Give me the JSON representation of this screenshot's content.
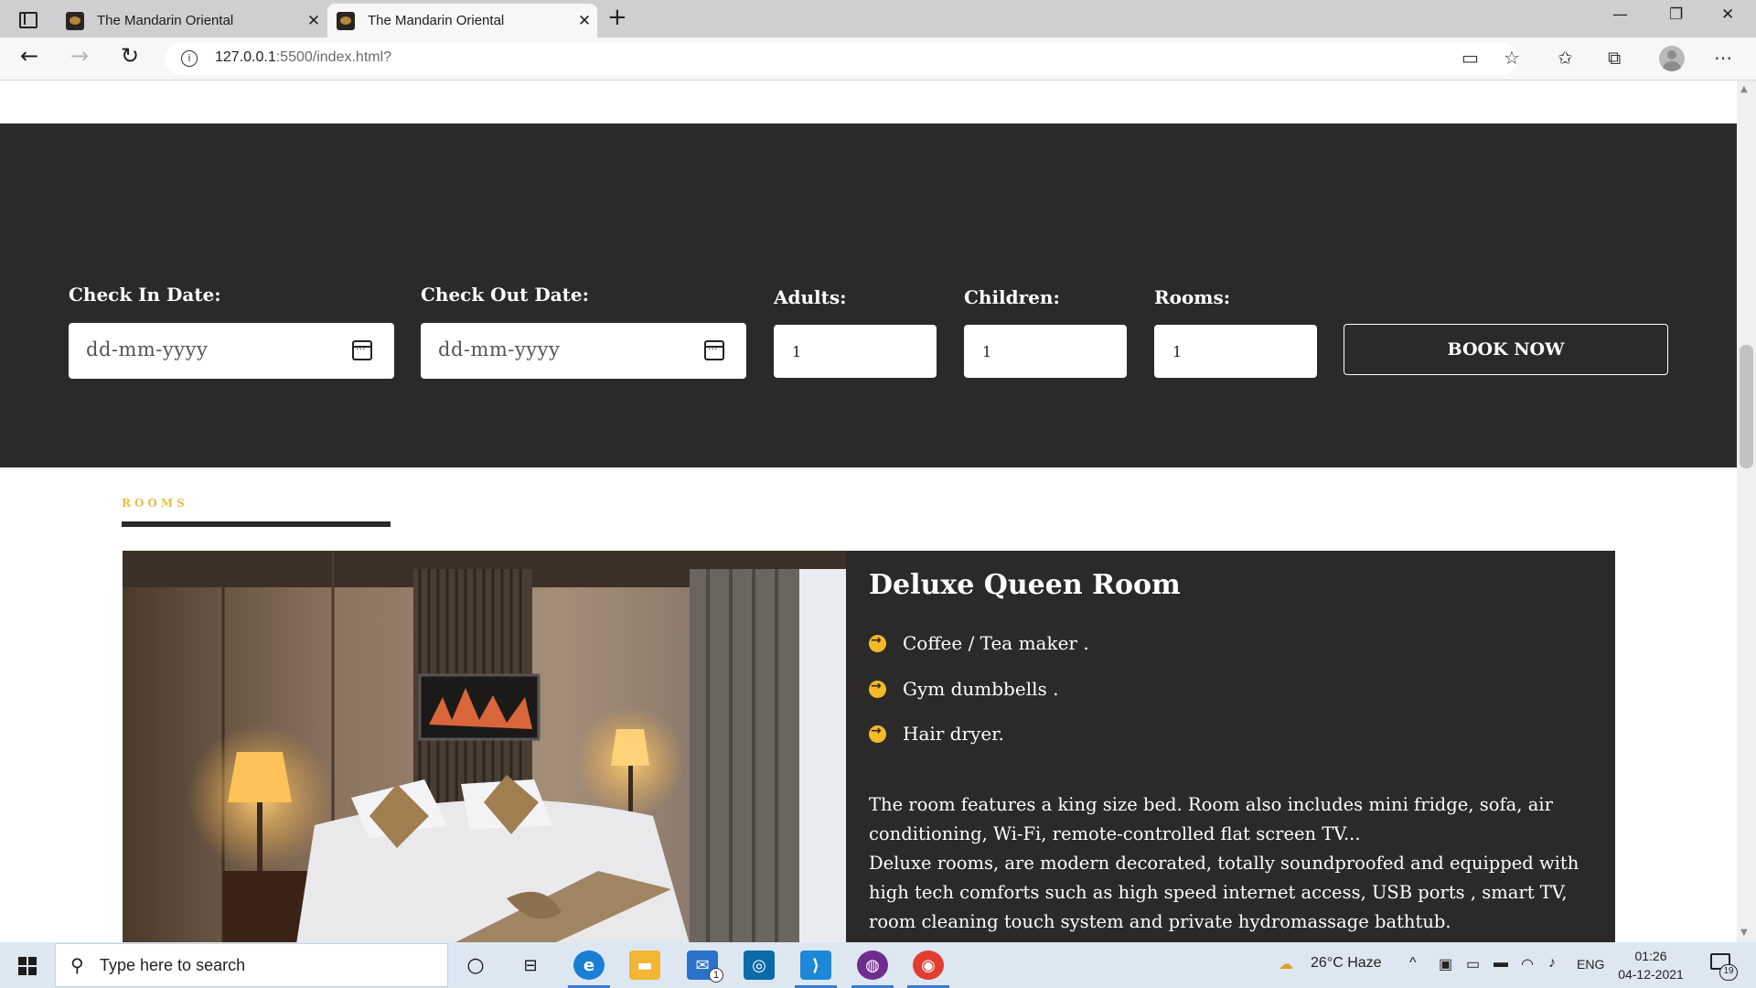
{
  "browser": {
    "tabs": [
      {
        "title": "The Mandarin Oriental",
        "active": false
      },
      {
        "title": "The Mandarin Oriental",
        "active": true
      }
    ],
    "new_tab": "+",
    "url_host": "127.0.0.1",
    "url_rest": ":5500/index.html?",
    "window_controls": {
      "minimize": "—",
      "maximize": "❐",
      "close": "✕"
    }
  },
  "booking": {
    "check_in": {
      "label": "Check  In  Date:",
      "placeholder": "dd-mm-yyyy"
    },
    "check_out": {
      "label": "Check  Out  Date:",
      "placeholder": "dd-mm-yyyy"
    },
    "adults": {
      "label": "Adults:",
      "value": "1"
    },
    "children": {
      "label": "Children:",
      "value": "1"
    },
    "rooms": {
      "label": "Rooms:",
      "value": "1"
    },
    "button": "BOOK NOW"
  },
  "rooms_section": {
    "label": "ROOMS",
    "room": {
      "title": "Deluxe Queen Room",
      "amenities": [
        "Coffee / Tea maker .",
        "Gym dumbbells .",
        "Hair dryer."
      ],
      "description_1": "The room features a king size bed. Room also includes mini fridge, sofa, air conditioning, Wi-Fi, remote-controlled flat screen TV...",
      "description_2": "Deluxe rooms, are modern decorated, totally soundproofed and equipped with high tech comforts such as high speed internet access, USB ports , smart TV, room cleaning touch system and private hydromassage bathtub."
    }
  },
  "taskbar": {
    "search_placeholder": "Type here to search",
    "weather": "26°C  Haze",
    "language": "ENG",
    "time": "01:26",
    "date": "04-12-2021",
    "mail_badge": "1",
    "notification_count": "19"
  },
  "colors": {
    "dark_panel": "#2b2a29",
    "accent_gold": "#e5c24a",
    "bullet_yellow": "#f6b928"
  }
}
